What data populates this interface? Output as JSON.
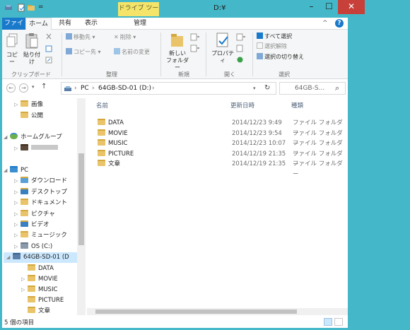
{
  "window": {
    "title": "D:¥",
    "tool_tab": "ドライブ ツール",
    "min_glyph": "–",
    "max_glyph": "☐",
    "close_glyph": "✕"
  },
  "ribbon_tabs": {
    "file": "ファイル",
    "home": "ホーム",
    "share": "共有",
    "view": "表示",
    "manage": "管理",
    "collapse_glyph": "^",
    "help_glyph": "?"
  },
  "ribbon": {
    "clipboard": {
      "copy": "コピー",
      "paste": "貼り付け",
      "label": "クリップボード"
    },
    "organize": {
      "move_to": "移動先 ▾",
      "copy_to": "コピー先 ▾",
      "delete": "削除 ▾",
      "rename": "名前の変更",
      "label": "整理"
    },
    "new": {
      "new_folder_1": "新しい",
      "new_folder_2": "フォルダー",
      "label": "新規"
    },
    "open": {
      "properties": "プロパティ",
      "label": "開く"
    },
    "select": {
      "select_all": "すべて選択",
      "select_none": "選択解除",
      "invert": "選択の切り替え",
      "label": "選択"
    }
  },
  "address": {
    "path": [
      "PC",
      "64GB-SD-01 (D:)"
    ],
    "search_placeholder": "64GB-S...",
    "back_glyph": "←",
    "forward_glyph": "→",
    "recent_glyph": "▾",
    "up_glyph": "↑",
    "sep_glyph": "›",
    "refresh_glyph": "↻",
    "search_icon_glyph": "⌕"
  },
  "nav_tree": [
    {
      "label": "画像",
      "expander": "▷"
    },
    {
      "label": "公開",
      "expander": ""
    },
    {
      "label": "ホームグループ",
      "expander": "◢"
    },
    {
      "label": "",
      "expander": "▷"
    },
    {
      "label": "PC",
      "expander": "◢"
    },
    {
      "label": "ダウンロード",
      "expander": "▷"
    },
    {
      "label": "デスクトップ",
      "expander": "▷"
    },
    {
      "label": "ドキュメント",
      "expander": "▷"
    },
    {
      "label": "ピクチャ",
      "expander": "▷"
    },
    {
      "label": "ビデオ",
      "expander": "▷"
    },
    {
      "label": "ミュージック",
      "expander": "▷"
    },
    {
      "label": "OS (C:)",
      "expander": "▷"
    },
    {
      "label": "64GB-SD-01 (D",
      "expander": "◢"
    },
    {
      "label": "DATA",
      "expander": ""
    },
    {
      "label": "MOVIE",
      "expander": "▷"
    },
    {
      "label": "MUSIC",
      "expander": "▷"
    },
    {
      "label": "PICTURE",
      "expander": ""
    },
    {
      "label": "文章",
      "expander": ""
    }
  ],
  "columns": {
    "name": "名前",
    "date": "更新日時",
    "type": "種類"
  },
  "files": [
    {
      "name": "DATA",
      "date": "2014/12/23 9:49",
      "type": "ファイル フォルダー"
    },
    {
      "name": "MOVIE",
      "date": "2014/12/23 9:54",
      "type": "ファイル フォルダー"
    },
    {
      "name": "MUSIC",
      "date": "2014/12/23 10:07",
      "type": "ファイル フォルダー"
    },
    {
      "name": "PICTURE",
      "date": "2014/12/19 21:35",
      "type": "ファイル フォルダー"
    },
    {
      "name": "文章",
      "date": "2014/12/19 21:35",
      "type": "ファイル フォルダー"
    }
  ],
  "status": {
    "count": "5 個の項目"
  },
  "colors": {
    "accent": "#1979ca",
    "frame": "#44b8c8",
    "tool_tab": "#f4e46a",
    "close": "#c7403a",
    "selection": "#cce8ff"
  }
}
